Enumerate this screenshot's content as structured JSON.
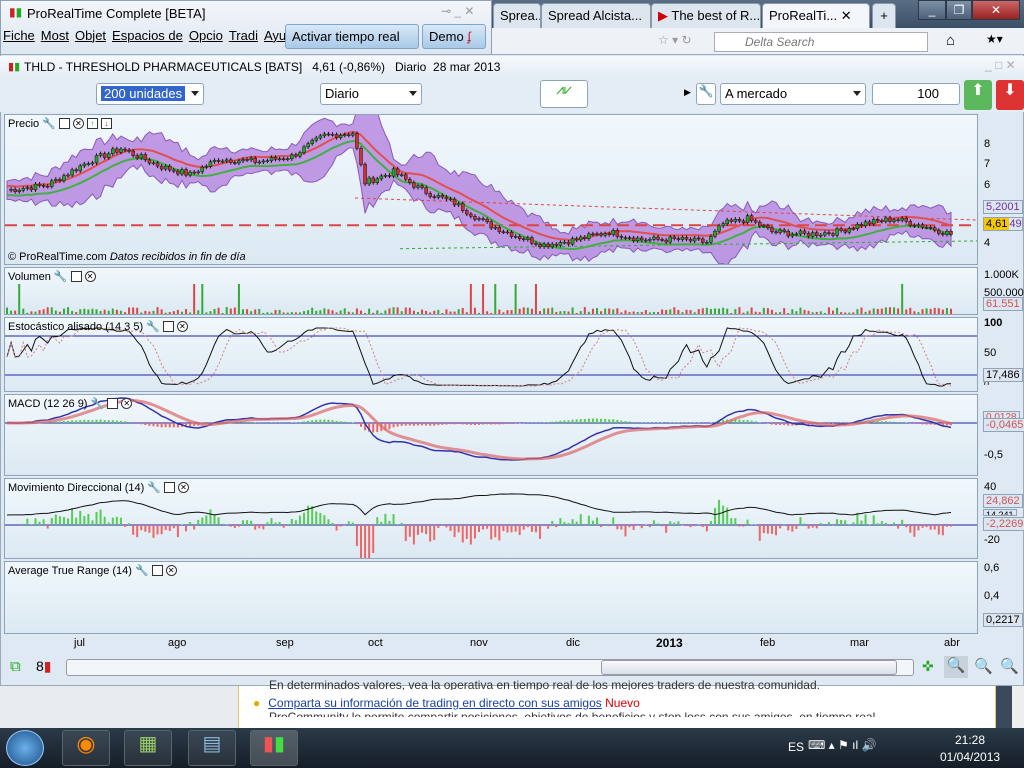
{
  "window": {
    "title": "ProRealTime Complete [BETA]",
    "menu": [
      "Fiche",
      "Most",
      "Objet",
      "Espacios de",
      "Opcio",
      "Tradi",
      "Ayu"
    ],
    "realtime_button": "Activar tiempo real",
    "demo_button": "Demo"
  },
  "browser": {
    "tabs": [
      "Sprea...",
      "Spread Alcista...",
      "The best of R...",
      "ProRealTi..."
    ],
    "new_tab": "+",
    "search_placeholder": "Delta Search"
  },
  "instrument": {
    "name": "THLD - THRESHOLD PHARMACEUTICALS [BATS]",
    "price": "4,61 (-0,86%)",
    "period": "Diario",
    "date": "28 mar 2013"
  },
  "toolbar": {
    "units": "200 unidades",
    "timeframe": "Diario",
    "order_type": "A mercado",
    "quantity": "100"
  },
  "panels": {
    "price": {
      "label": "Precio",
      "ticks": [
        "8",
        "7",
        "6",
        "4"
      ],
      "values": [
        "5,2001",
        "4,61",
        "49"
      ],
      "copyright": "© ProRealTime.com",
      "note": "Datos recibidos in fin de día"
    },
    "volume": {
      "label": "Volumen",
      "ticks": [
        "1.000K",
        "500.000"
      ],
      "value": "61.551"
    },
    "stoch": {
      "label": "Estocástico alisado (14 3 5)",
      "ticks": [
        "100",
        "50",
        "0"
      ],
      "value": "17,486"
    },
    "macd": {
      "label": "MACD (12 26 9)",
      "ticks": [
        "-0,5"
      ],
      "values": [
        "0,0128",
        "-0,0465"
      ]
    },
    "dmi": {
      "label": "Movimiento Direccional (14)",
      "ticks": [
        "40",
        "-20"
      ],
      "values": [
        "24,862",
        "14,241",
        "-2,2269"
      ]
    },
    "atr": {
      "label": "Average True Range (14)",
      "ticks": [
        "0,6",
        "0,4"
      ],
      "value": "0,2217"
    }
  },
  "months": [
    "jul",
    "ago",
    "sep",
    "oct",
    "nov",
    "dic",
    "2013",
    "feb",
    "mar",
    "abr"
  ],
  "web": {
    "line1": "En determinados valores, vea la operativa en tiempo real de los mejores traders de nuestra comunidad.",
    "link": "Comparta su información de trading en directo con sus amigos",
    "badge": "Nuevo",
    "line3": "ProCommunity le permite compartir posiciones, objetivos de beneficios y stop loss con sus amigos, en tiempo real."
  },
  "taskbar": {
    "lang": "ES",
    "time": "21:28",
    "date": "01/04/2013"
  },
  "chart_data": {
    "type": "candlestick",
    "x_range": [
      "jun 2012",
      "mar 2013"
    ],
    "price_keypoints": [
      [
        0,
        6.3
      ],
      [
        10,
        6.5
      ],
      [
        20,
        7.4
      ],
      [
        28,
        7.9
      ],
      [
        38,
        7.2
      ],
      [
        45,
        6.9
      ],
      [
        52,
        7.5
      ],
      [
        62,
        7.4
      ],
      [
        70,
        7.6
      ],
      [
        78,
        8.4
      ],
      [
        85,
        8.5
      ],
      [
        88,
        6.6
      ],
      [
        95,
        7.0
      ],
      [
        102,
        6.3
      ],
      [
        110,
        5.8
      ],
      [
        118,
        5.0
      ],
      [
        126,
        4.5
      ],
      [
        132,
        4.2
      ],
      [
        140,
        4.4
      ],
      [
        148,
        4.7
      ],
      [
        156,
        4.4
      ],
      [
        165,
        4.4
      ],
      [
        172,
        4.3
      ],
      [
        176,
        5.0
      ],
      [
        182,
        5.2
      ],
      [
        188,
        4.7
      ],
      [
        196,
        4.6
      ],
      [
        204,
        4.7
      ],
      [
        210,
        5.0
      ],
      [
        218,
        5.2
      ],
      [
        226,
        4.9
      ],
      [
        232,
        4.61
      ]
    ],
    "colors": {
      "up": "#22aa22",
      "down": "#cc3333",
      "band": "#a070d0"
    }
  }
}
